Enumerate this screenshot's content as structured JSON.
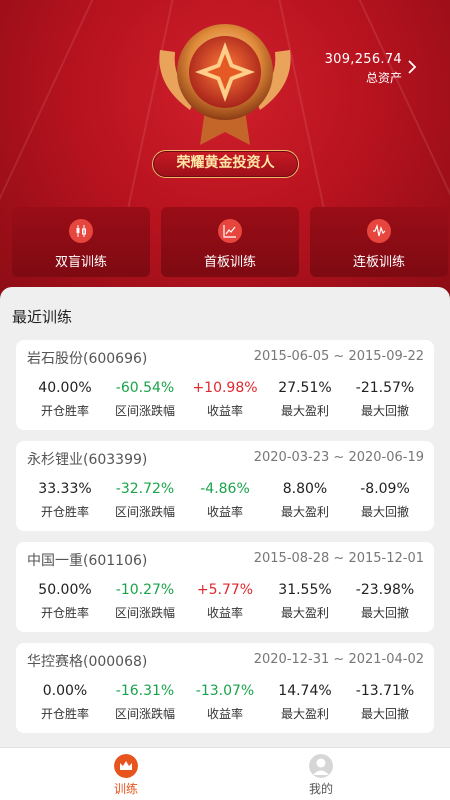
{
  "header": {
    "total_asset_value": "309,256.74",
    "total_asset_label": "总资产",
    "level_title": "荣耀黄金投资人"
  },
  "modes": [
    {
      "label": "双盲训练",
      "icon": "candlestick-icon"
    },
    {
      "label": "首板训练",
      "icon": "line-chart-icon"
    },
    {
      "label": "连板训练",
      "icon": "wave-icon"
    }
  ],
  "recent": {
    "title": "最近训练",
    "stat_labels": [
      "开仓胜率",
      "区间涨跌幅",
      "收益率",
      "最大盈利",
      "最大回撤"
    ],
    "records": [
      {
        "name": "岩石股份(600696)",
        "range": "2015-06-05 ~ 2015-09-22",
        "values": [
          "40.00%",
          "-60.54%",
          "+10.98%",
          "27.51%",
          "-21.57%"
        ]
      },
      {
        "name": "永杉锂业(603399)",
        "range": "2020-03-23 ~ 2020-06-19",
        "values": [
          "33.33%",
          "-32.72%",
          "-4.86%",
          "8.80%",
          "-8.09%"
        ]
      },
      {
        "name": "中国一重(601106)",
        "range": "2015-08-28 ~ 2015-12-01",
        "values": [
          "50.00%",
          "-10.27%",
          "+5.77%",
          "31.55%",
          "-23.98%"
        ]
      },
      {
        "name": "华控赛格(000068)",
        "range": "2020-12-31 ~ 2021-04-02",
        "values": [
          "0.00%",
          "-16.31%",
          "-13.07%",
          "14.74%",
          "-13.71%"
        ]
      }
    ]
  },
  "tabbar": {
    "train_label": "训练",
    "mine_label": "我的",
    "active_color": "#e8541e",
    "inactive_color": "#555555"
  },
  "colors": {
    "brand_red": "#b8131f",
    "gain": "#e0282e",
    "loss": "#1aa34a"
  }
}
